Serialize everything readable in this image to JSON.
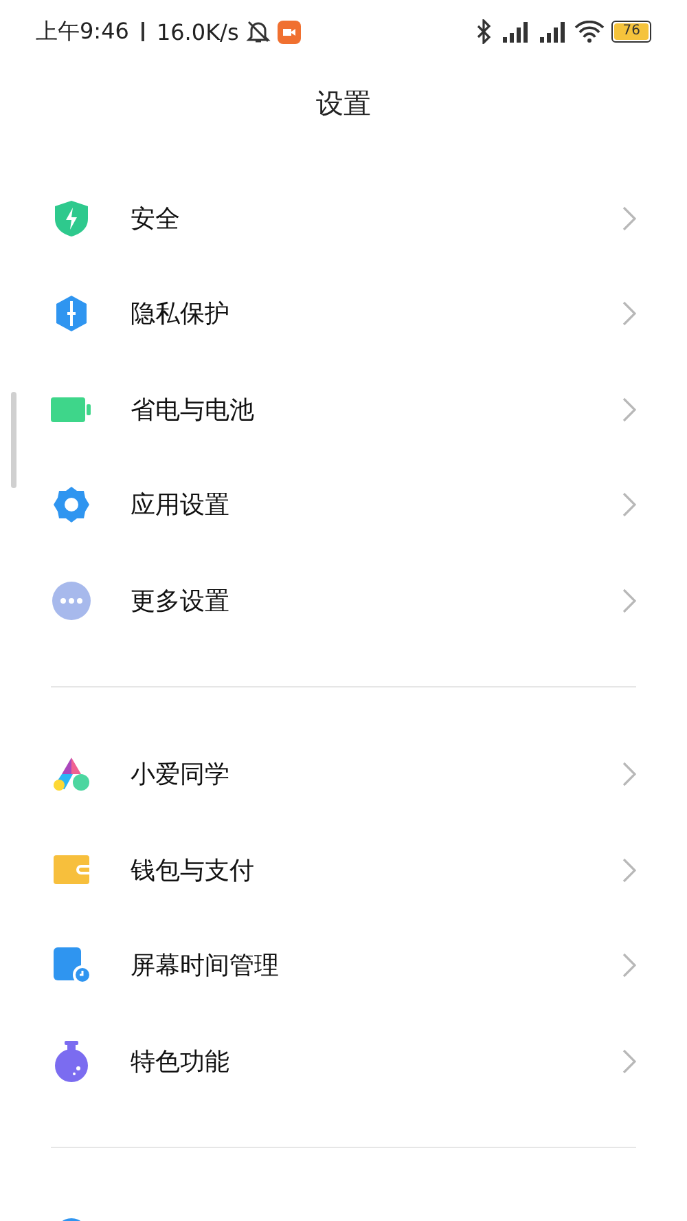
{
  "status_bar": {
    "time": "上午9:46",
    "speed": "16.0K/s",
    "battery": "76"
  },
  "title": "设置",
  "sections": [
    {
      "items": [
        {
          "label": "安全"
        },
        {
          "label": "隐私保护"
        },
        {
          "label": "省电与电池"
        },
        {
          "label": "应用设置"
        },
        {
          "label": "更多设置"
        }
      ]
    },
    {
      "items": [
        {
          "label": "小爱同学"
        },
        {
          "label": "钱包与支付"
        },
        {
          "label": "屏幕时间管理"
        },
        {
          "label": "特色功能"
        }
      ]
    }
  ]
}
